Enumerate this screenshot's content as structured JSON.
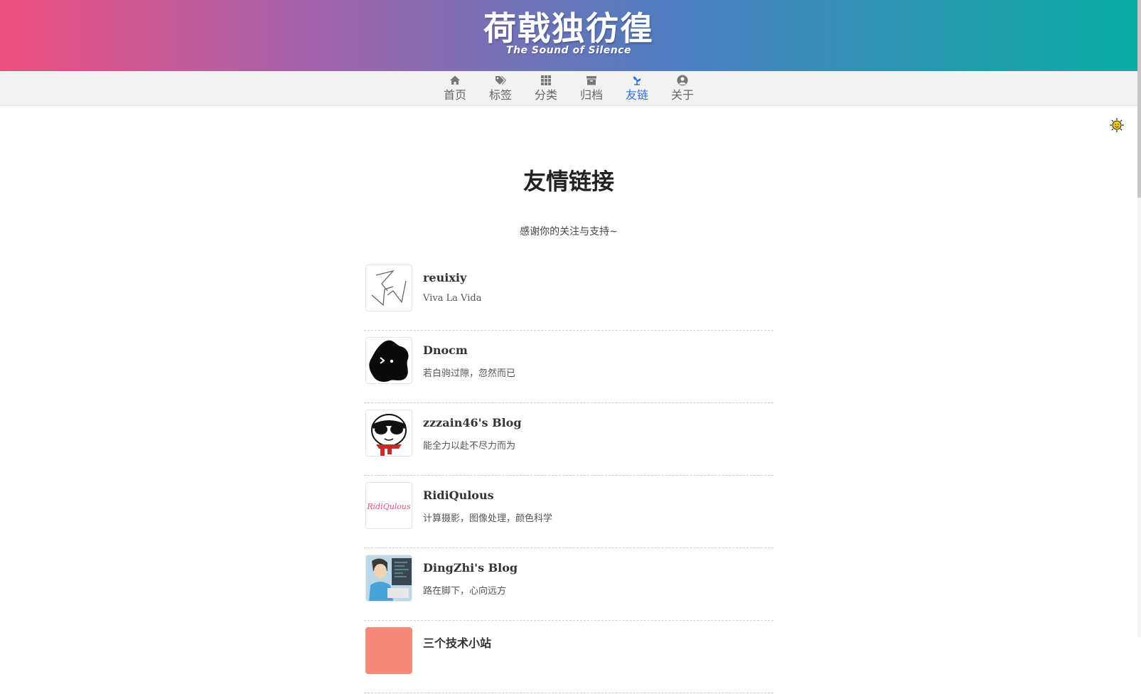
{
  "header": {
    "logo_text": "荷戟独彷徨",
    "logo_subtitle": "The Sound of Silence"
  },
  "nav": [
    {
      "label": "首页",
      "icon": "home-icon"
    },
    {
      "label": "标签",
      "icon": "tags-icon"
    },
    {
      "label": "分类",
      "icon": "grid-icon"
    },
    {
      "label": "归档",
      "icon": "archive-icon"
    },
    {
      "label": "友链",
      "icon": "sprout-icon",
      "active": true
    },
    {
      "label": "关于",
      "icon": "user-circle-icon"
    }
  ],
  "theme_toggle_icon": "sun-icon",
  "page": {
    "title": "友情链接",
    "subtitle": "感谢你的关注与支持~"
  },
  "links": [
    {
      "name": "reuixiy",
      "desc": "Viva La Vida",
      "avatar_icon": "triskelion-line-icon"
    },
    {
      "name": "Dnocm",
      "desc": "若白驹过隙，忽然而已",
      "avatar_icon": "black-blob-face-icon"
    },
    {
      "name": "zzzain46's Blog",
      "desc": "能全力以赴不尽力而为",
      "avatar_icon": "sunglasses-face-icon"
    },
    {
      "name": "RidiQulous",
      "desc": "计算摄影，图像处理，颜色科学",
      "avatar_icon": "ridiqulous-script-logo",
      "avatar_text": "RidiQulous"
    },
    {
      "name": "DingZhi's Blog",
      "desc": "路在脚下，心向远方",
      "avatar_icon": "developer-cartoon-icon"
    },
    {
      "name": "三个技术小站",
      "desc": "",
      "avatar_icon": "salmon-square-icon"
    }
  ],
  "colors": {
    "gradient": [
      "#ef4f7f",
      "#a263ac",
      "#4b7ec0",
      "#09aca2"
    ],
    "nav_active": "#2d6fe0",
    "nav_background": "#f2f2f2"
  }
}
